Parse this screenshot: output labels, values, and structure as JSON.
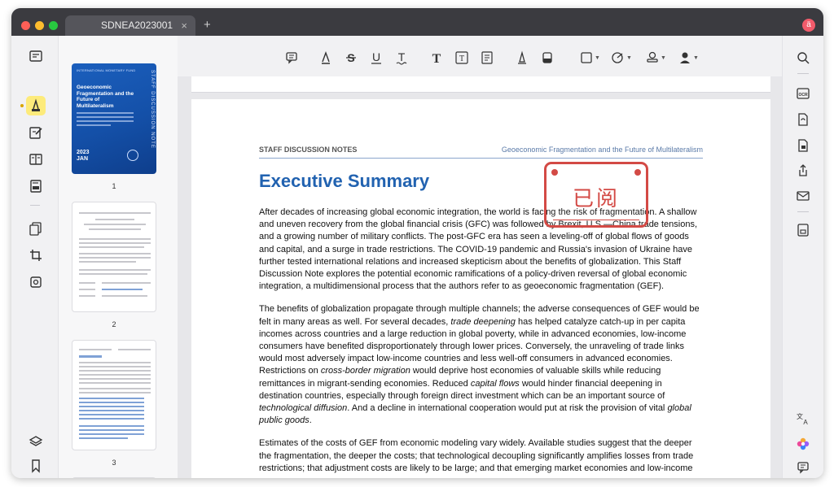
{
  "window": {
    "tab_title": "SDNEA2023001",
    "tab_close": "×",
    "new_tab": "+",
    "avatar_initial": "ä"
  },
  "thumbnails": [
    {
      "number": "1"
    },
    {
      "number": "2"
    },
    {
      "number": "3"
    }
  ],
  "cover": {
    "org": "INTERNATIONAL MONETARY FUND",
    "title": "Geoeconomic Fragmentation and the Future of Multilateralism",
    "side_label": "STAFF DISCUSSION NOTE",
    "year": "2023",
    "month": "JAN"
  },
  "toolbar": {
    "icons": [
      "comment-icon",
      "highlight-icon",
      "strikethrough-icon",
      "underline-icon",
      "squiggly-underline-icon",
      "text-icon",
      "text-box-icon",
      "text-callout-icon",
      "pencil-icon",
      "eraser-icon",
      "shape-icon",
      "sticky-note-icon",
      "stamp-icon",
      "signature-icon"
    ]
  },
  "document": {
    "running_head_left": "STAFF DISCUSSION NOTES",
    "running_head_right": "Geoeconomic Fragmentation and the Future of Multilateralism",
    "heading": "Executive Summary",
    "stamp_text": "已阅",
    "paragraph1": "After decades of increasing global economic integration, the world is facing the risk of fragmentation. A shallow and uneven recovery from the global financial crisis (GFC) was followed by Brexit, U.S.—China trade tensions, and a growing number of military conflicts. The post-GFC era has seen a leveling-off of global flows of goods and capital, and a surge in trade restrictions. The COVID-19 pandemic and Russia's invasion of Ukraine have further tested international relations and increased skepticism about the benefits of globalization. This Staff Discussion Note explores the potential economic ramifications of a policy-driven reversal of global economic integration, a multidimensional process that the authors refer to as geoeconomic fragmentation (GEF).",
    "p2_a": "The benefits of globalization propagate through multiple channels; the adverse consequences of GEF would be felt in many areas as well. For several decades, ",
    "p2_i1": "trade deepening",
    "p2_b": " has helped catalyze catch-up in per capita incomes across countries and a large reduction in global poverty, while in advanced economies, low-income consumers have benefited disproportionately through lower prices. Conversely, the unraveling of trade links would most adversely impact low-income countries and less well-off consumers in advanced economies. Restrictions on ",
    "p2_i2": "cross-border migration",
    "p2_c": " would deprive host economies of valuable skills while reducing remittances in migrant-sending economies. Reduced ",
    "p2_i3": "capital flows",
    "p2_d": " would hinder financial deepening in destination countries, especially through foreign direct investment which can be an important source of ",
    "p2_i4": "technological diffusion",
    "p2_e": ". And a decline in international cooperation would put at risk the provision of vital ",
    "p2_i5": "global public goods",
    "p2_f": ".",
    "paragraph3": "Estimates of the costs of GEF from economic modeling vary widely. Available studies suggest that the deeper the fragmentation, the deeper the costs; that technological decoupling significantly amplifies losses from trade restrictions; that adjustment costs are likely to be large; and that emerging market economies and low-income"
  },
  "colors": {
    "accent_blue": "#2162b0",
    "stamp_red": "#d34a45",
    "active_tool": "#fdeb7b"
  }
}
